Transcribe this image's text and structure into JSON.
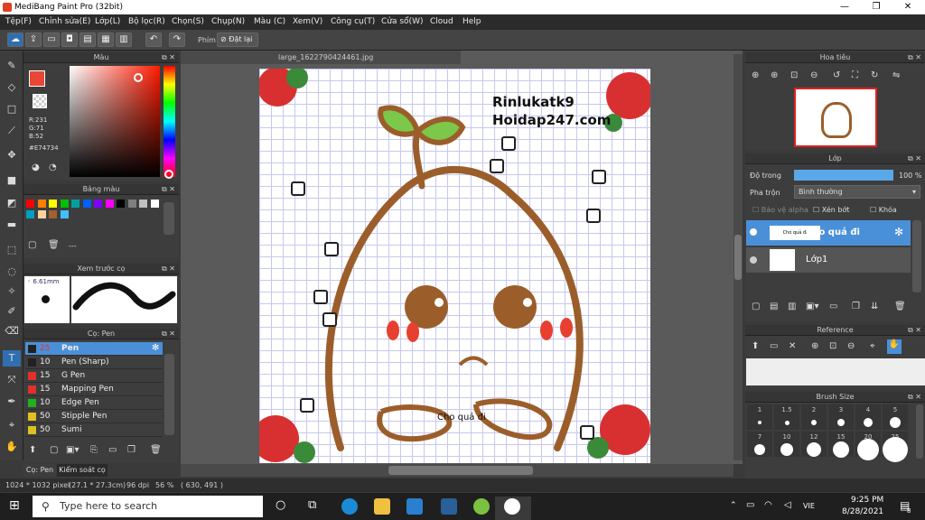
{
  "window": {
    "title": "MediBang Paint Pro (32bit)"
  },
  "menu": [
    "Tệp(F)",
    "Chỉnh sửa(E)",
    "Lớp(L)",
    "Bộ lọc(R)",
    "Chọn(S)",
    "Chụp(N)",
    "Màu (C)",
    "Xem(V)",
    "Công cụ(T)",
    "Cửa sổ(W)",
    "Cloud",
    "Help"
  ],
  "toolbar": {
    "shortcut_label": "Phím",
    "reset_label": "Đặt lại"
  },
  "color_panel": {
    "title": "Màu",
    "r": "R:231",
    "g": "G:71",
    "b": "B:52",
    "hex": "#E74734",
    "main_color": "#E74734"
  },
  "palette_panel": {
    "title": "Bảng màu",
    "more": "---",
    "colors": [
      "#ff0000",
      "#ff8000",
      "#ffff00",
      "#00c000",
      "#00a0a0",
      "#0060ff",
      "#8000ff",
      "#ff00ff",
      "#000000",
      "#808080",
      "#c0c0c0",
      "#ffffff",
      "#00a0c0",
      "#ffd0a0",
      "#a06030",
      "#40c0ff"
    ]
  },
  "brush_preview": {
    "title": "Xem trước cọ",
    "size": "6.61mm"
  },
  "brush_panel": {
    "title": "Cọ: Pen",
    "items": [
      {
        "size": "25",
        "name": "Pen",
        "color": "#222222",
        "selected": true
      },
      {
        "size": "10",
        "name": "Pen (Sharp)",
        "color": "#222222"
      },
      {
        "size": "15",
        "name": "G Pen",
        "color": "#e03030"
      },
      {
        "size": "15",
        "name": "Mapping Pen",
        "color": "#e03030"
      },
      {
        "size": "10",
        "name": "Edge Pen",
        "color": "#20b020"
      },
      {
        "size": "50",
        "name": "Stipple Pen",
        "color": "#e0c020"
      },
      {
        "size": "50",
        "name": "Sumi",
        "color": "#e0c020"
      }
    ],
    "tab_brush": "Cọ: Pen",
    "tab_control": "Kiểm soát cọ"
  },
  "canvas": {
    "tab": "large_1622790424461.jpg",
    "watermark1": "Rinlukatk9",
    "watermark2": "Hoidap247.com",
    "caption": "Cho quả đi"
  },
  "navigator": {
    "title": "Hoa tiêu"
  },
  "layer_panel": {
    "title": "Lớp",
    "opacity_label": "Độ trong",
    "opacity": "100 %",
    "opacity_value": 100,
    "blend_label": "Pha trộn",
    "blend": "Bình thường",
    "protect_alpha": "Bảo vệ alpha",
    "clipping": "Xén bớt",
    "lock": "Khóa",
    "layers": [
      {
        "name": "Cho quả đi",
        "thumb": "Cho quả đi",
        "selected": true
      },
      {
        "name": "Lớp1"
      }
    ]
  },
  "reference_panel": {
    "title": "Reference"
  },
  "brush_size_panel": {
    "title": "Brush Size",
    "sizes": [
      "1",
      "1.5",
      "2",
      "3",
      "4",
      "5",
      "7",
      "10",
      "12",
      "15",
      "20",
      "25"
    ]
  },
  "status": {
    "dimensions": "1024 * 1032 pixel",
    "physical": "(27.1 * 27.3cm)",
    "dpi": "96 dpi",
    "zoom": "56 %",
    "coords": "( 630, 491 )"
  },
  "taskbar": {
    "search_placeholder": "Type here to search",
    "time": "9:25 PM",
    "date": "8/28/2021",
    "lang": "VIE",
    "notif_count": "8"
  }
}
